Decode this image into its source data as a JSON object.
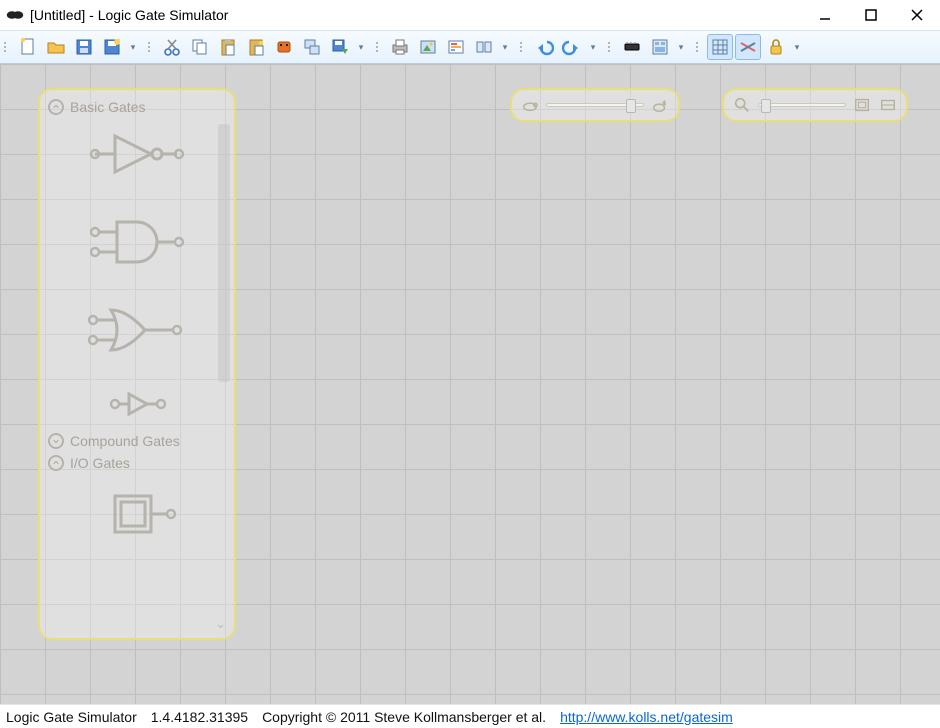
{
  "window": {
    "title": "[Untitled] - Logic Gate Simulator"
  },
  "toolbar": {
    "groups": [
      {
        "buttons": [
          "new-file",
          "open-file",
          "save-file",
          "save-as"
        ],
        "overflow": true
      },
      {
        "buttons": [
          "cut",
          "copy",
          "paste",
          "paste-special",
          "embed-ic",
          "align",
          "save-selection"
        ],
        "overflow": true
      },
      {
        "buttons": [
          "print",
          "export-image",
          "show-oscilloscope",
          "hide-overlays"
        ],
        "overflow": true
      },
      {
        "buttons": [
          "undo",
          "redo"
        ],
        "overflow": true
      },
      {
        "buttons": [
          "flatten-ic",
          "view-ic-contents"
        ],
        "overflow": true
      },
      {
        "buttons": [
          "snap-to-grid",
          "inline-wires",
          "lock"
        ],
        "overflow": true,
        "active": [
          "snap-to-grid",
          "inline-wires"
        ]
      }
    ]
  },
  "palette": {
    "sections": [
      {
        "label": "Basic Gates",
        "expanded": true,
        "items": [
          "not-gate",
          "and-gate",
          "or-gate",
          "buffer"
        ]
      },
      {
        "label": "Compound Gates",
        "expanded": false,
        "items": []
      },
      {
        "label": "I/O Gates",
        "expanded": true,
        "items": [
          "user-output"
        ]
      }
    ]
  },
  "controls": {
    "speed_slider": {
      "value": 0.88,
      "min": 0,
      "max": 1
    },
    "zoom_slider": {
      "value": 0.08,
      "min": 0,
      "max": 1
    }
  },
  "statusbar": {
    "app_name": "Logic Gate Simulator",
    "version": "1.4.4182.31395",
    "copyright": "Copyright © 2011 Steve Kollmansberger et al.",
    "link_text": "http://www.kolls.net/gatesim",
    "link_href": "http://www.kolls.net/gatesim"
  },
  "colors": {
    "accent_border": "#e8df7a",
    "grid_line": "#bfbfbf",
    "canvas_bg": "#d3d3d3",
    "toolbar_active": "#d2e7fb"
  }
}
